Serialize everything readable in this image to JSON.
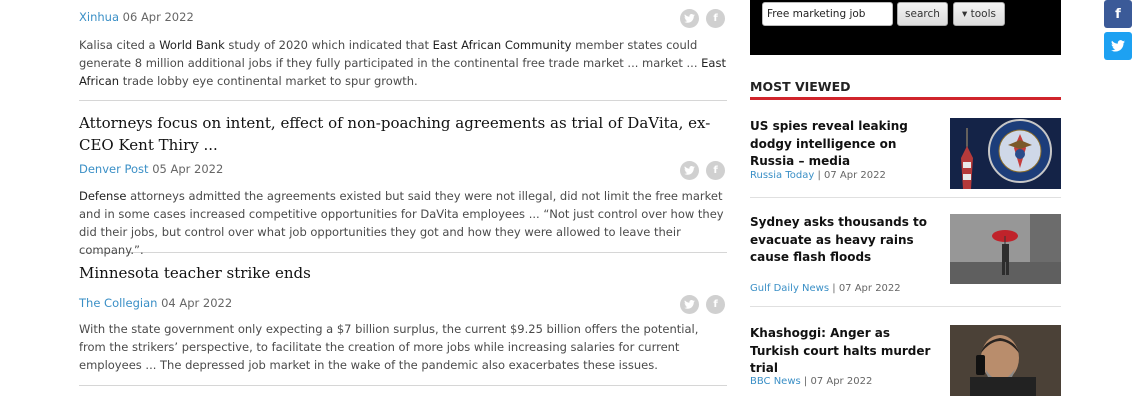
{
  "articles": [
    {
      "source": "Xinhua",
      "date": "06 Apr 2022",
      "summary_parts": [
        "Kalisa cited a ",
        "World Bank",
        " study of 2020 which indicated that ",
        "East African Community",
        " member states could generate 8 million additional jobs if they fully participated in the continental free trade market ... market ... ",
        "East African",
        " trade lobby eye continental market to spur growth."
      ]
    },
    {
      "headline": "Attorneys focus on intent, effect of non-poaching agreements as trial of DaVita, ex-CEO Kent Thiry ...",
      "source": "Denver Post",
      "date": "05 Apr 2022",
      "summary_parts": [
        "Defense",
        " attorneys admitted the agreements existed but said they were not illegal, did not limit the free market and in some cases increased competitive opportunities for DaVita employees ... “Not just control over how they did their jobs, but control over what job opportunities they got and how they were allowed to leave their company.”."
      ]
    },
    {
      "headline": "Minnesota teacher strike ends",
      "source": "The Collegian",
      "date": "04 Apr 2022",
      "summary_parts": [
        "With the state government only expecting a $7 billion surplus, the current $9.25 billion offers the potential, from the strikers’ perspective, to facilitate the creation of more jobs while increasing salaries for current employees ... The depressed job market in the wake of the pandemic also exacerbates these issues."
      ]
    }
  ],
  "share_icons": {
    "twitter": "twitter-icon",
    "facebook": "facebook-icon"
  },
  "search": {
    "value": "Free marketing job",
    "search_label": "search",
    "tools_label": "▾ tools"
  },
  "most_viewed": {
    "title": "MOST VIEWED",
    "items": [
      {
        "headline": "US spies reveal leaking dodgy intelligence on Russia – media",
        "source": "Russia Today",
        "sep": " | ",
        "date": "07 Apr 2022"
      },
      {
        "headline": "Sydney asks thousands to evacuate as heavy rains cause flash floods",
        "source": "Gulf Daily News",
        "sep": " | ",
        "date": "07 Apr 2022"
      },
      {
        "headline": "Khashoggi: Anger as Turkish court halts murder trial",
        "source": "BBC News",
        "sep": " | ",
        "date": "07 Apr 2022"
      }
    ]
  },
  "floating_social": {
    "facebook": "f"
  },
  "colors": {
    "link": "#3a8fc6",
    "accent_red": "#d0242b",
    "facebook": "#3b5a98",
    "twitter": "#1da1f2"
  }
}
